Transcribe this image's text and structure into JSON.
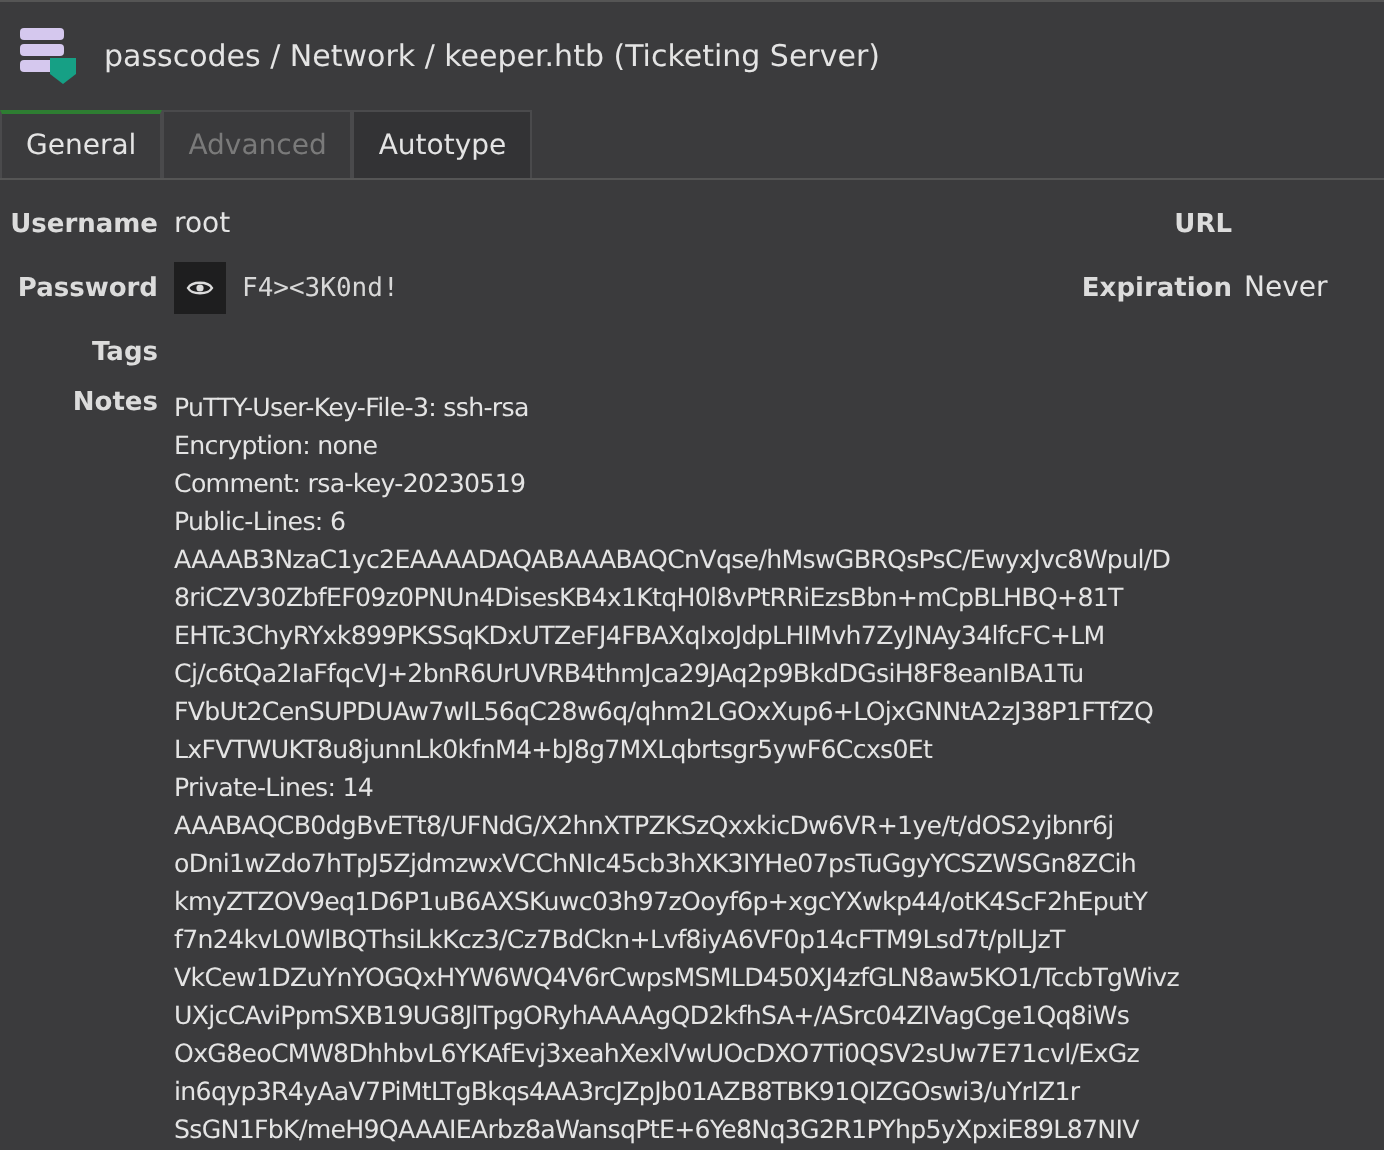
{
  "header": {
    "title": "passcodes / Network / keeper.htb (Ticketing Server)"
  },
  "tabs": [
    {
      "label": "General",
      "selected": true,
      "disabled": false
    },
    {
      "label": "Advanced",
      "selected": false,
      "disabled": true
    },
    {
      "label": "Autotype",
      "selected": false,
      "disabled": false
    }
  ],
  "fields": {
    "username": {
      "label": "Username",
      "value": "root"
    },
    "url": {
      "label": "URL"
    },
    "password": {
      "label": "Password",
      "value": "F4><3K0nd!"
    },
    "expiration": {
      "label": "Expiration",
      "value": "Never"
    },
    "tags": {
      "label": "Tags"
    },
    "notes": {
      "label": "Notes",
      "lines": [
        "PuTTY-User-Key-File-3: ssh-rsa",
        "Encryption: none",
        "Comment: rsa-key-20230519",
        "Public-Lines: 6",
        "AAAAB3NzaC1yc2EAAAADAQABAAABAQCnVqse/hMswGBRQsPsC/EwyxJvc8Wpul/D",
        "8riCZV30ZbfEF09z0PNUn4DisesKB4x1KtqH0l8vPtRRiEzsBbn+mCpBLHBQ+81T",
        "EHTc3ChyRYxk899PKSSqKDxUTZeFJ4FBAXqIxoJdpLHIMvh7ZyJNAy34lfcFC+LM",
        "Cj/c6tQa2IaFfqcVJ+2bnR6UrUVRB4thmJca29JAq2p9BkdDGsiH8F8eanIBA1Tu",
        "FVbUt2CenSUPDUAw7wIL56qC28w6q/qhm2LGOxXup6+LOjxGNNtA2zJ38P1FTfZQ",
        "LxFVTWUKT8u8junnLk0kfnM4+bJ8g7MXLqbrtsgr5ywF6Ccxs0Et",
        "Private-Lines: 14",
        "AAABAQCB0dgBvETt8/UFNdG/X2hnXTPZKSzQxxkicDw6VR+1ye/t/dOS2yjbnr6j",
        "oDni1wZdo7hTpJ5ZjdmzwxVCChNIc45cb3hXK3IYHe07psTuGgyYCSZWSGn8ZCih",
        "kmyZTZOV9eq1D6P1uB6AXSKuwc03h97zOoyf6p+xgcYXwkp44/otK4ScF2hEputY",
        "f7n24kvL0WlBQThsiLkKcz3/Cz7BdCkn+Lvf8iyA6VF0p14cFTM9Lsd7t/plLJzT",
        "VkCew1DZuYnYOGQxHYW6WQ4V6rCwpsMSMLD450XJ4zfGLN8aw5KO1/TccbTgWivz",
        "UXjcCAviPpmSXB19UG8JlTpgORyhAAAAgQD2kfhSA+/ASrc04ZIVagCge1Qq8iWs",
        "OxG8eoCMW8DhhbvL6YKAfEvj3xeahXexlVwUOcDXO7Ti0QSV2sUw7E71cvl/ExGz",
        "in6qyp3R4yAaV7PiMtLTgBkqs4AA3rcJZpJb01AZB8TBK91QIZGOswi3/uYrIZ1r",
        "SsGN1FbK/meH9QAAAIEArbz8aWansqPtE+6Ye8Nq3G2R1PYhp5yXpxiE89L87NIV"
      ]
    }
  }
}
